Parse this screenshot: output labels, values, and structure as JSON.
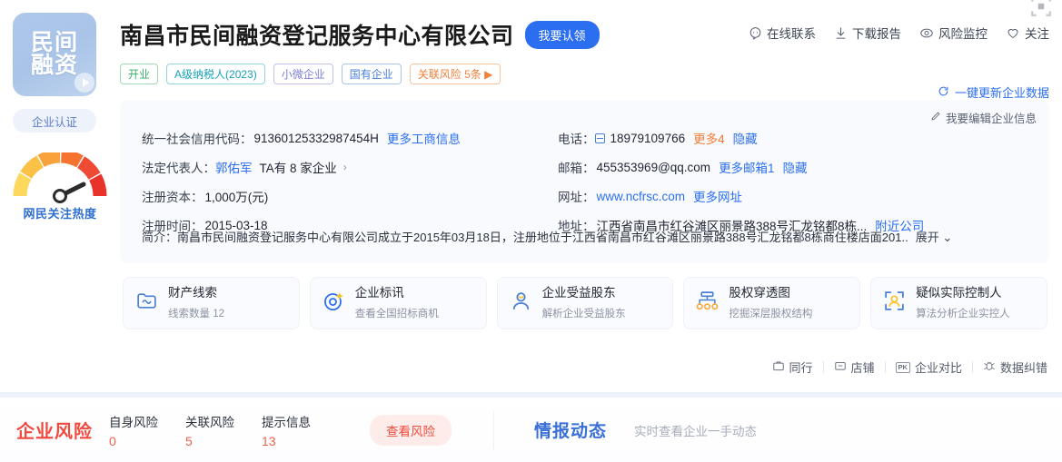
{
  "logo": {
    "line1": "民间",
    "line2": "融资",
    "cert_label": "企业认证"
  },
  "heat": {
    "label": "网民关注热度"
  },
  "header": {
    "title": "南昌市民间融资登记服务中心有限公司",
    "claim_button": "我要认领",
    "actions": [
      {
        "label": "在线联系",
        "icon": "chat-icon"
      },
      {
        "label": "下载报告",
        "icon": "download-icon"
      },
      {
        "label": "风险监控",
        "icon": "eye-icon"
      },
      {
        "label": "关注",
        "icon": "heart-icon"
      }
    ],
    "tags": [
      {
        "label": "开业",
        "color": "green"
      },
      {
        "label": "A级纳税人(2023)",
        "color": "teal"
      },
      {
        "label": "小微企业",
        "color": "violet"
      },
      {
        "label": "国有企业",
        "color": "blue"
      },
      {
        "label": "关联风险 5条 ▶",
        "color": "orange"
      }
    ],
    "update_link": "一键更新企业数据"
  },
  "info": {
    "edit_link": "我要编辑企业信息",
    "credit_code_label": "统一社会信用代码：",
    "credit_code_value": "91360125332987454H",
    "credit_code_more": "更多工商信息",
    "legal_label": "法定代表人：",
    "legal_name": "郭佑军",
    "legal_other": "TA有 8 家企业",
    "capital_label": "注册资本：",
    "capital_value": "1,000万(元)",
    "reg_date_label": "注册时间：",
    "reg_date_value": "2015-03-18",
    "phone_label": "电话：",
    "phone_value": "18979109766",
    "phone_more": "更多4",
    "phone_hide": "隐藏",
    "email_label": "邮箱：",
    "email_value": "455353969@qq.com",
    "email_more": "更多邮箱1",
    "email_hide": "隐藏",
    "site_label": "网址：",
    "site_value": "www.ncfrsc.com",
    "site_more": "更多网址",
    "addr_label": "地址：",
    "addr_value": "江西省南昌市红谷滩区丽景路388号汇龙铭都8栋...",
    "addr_near": "附近公司",
    "desc_label": "简介：",
    "desc_value": "南昌市民间融资登记服务中心有限公司成立于2015年03月18日，注册地位于江西省南昌市红谷滩区丽景路388号汇龙铭都8栋商住楼店面201..",
    "desc_toggle": "展开 ⌄"
  },
  "feature_cards": [
    {
      "icon": "folder-icon",
      "title": "财产线索",
      "sub": "线索数量 12"
    },
    {
      "icon": "target-icon",
      "title": "企业标讯",
      "sub": "查看全国招标商机"
    },
    {
      "icon": "person-icon",
      "title": "企业受益股东",
      "sub": "解析企业受益股东"
    },
    {
      "icon": "org-chart-icon",
      "title": "股权穿透图",
      "sub": "挖掘深层股权结构"
    },
    {
      "icon": "scan-person-icon",
      "title": "疑似实际控制人",
      "sub": "算法分析企业实控人"
    }
  ],
  "midbar": [
    {
      "icon": "briefcase-icon",
      "label": "同行"
    },
    {
      "icon": "shop-icon",
      "label": "店铺"
    },
    {
      "icon": "pk-icon",
      "label": "企业对比"
    },
    {
      "icon": "bug-icon",
      "label": "数据纠错"
    }
  ],
  "bottom": {
    "risk_title": "企业风险",
    "stats": [
      {
        "key": "自身风险",
        "value": "0"
      },
      {
        "key": "关联风险",
        "value": "5"
      },
      {
        "key": "提示信息",
        "value": "13"
      }
    ],
    "risk_button": "查看风险",
    "intel_title": "情报动态",
    "intel_sub": "实时查看企业一手动态"
  },
  "colors": {
    "accent_blue": "#2b6ef0",
    "risk_red": "#f04a3f",
    "intel_blue": "#3a6fd8",
    "logo_blue": "#aec8ea"
  }
}
